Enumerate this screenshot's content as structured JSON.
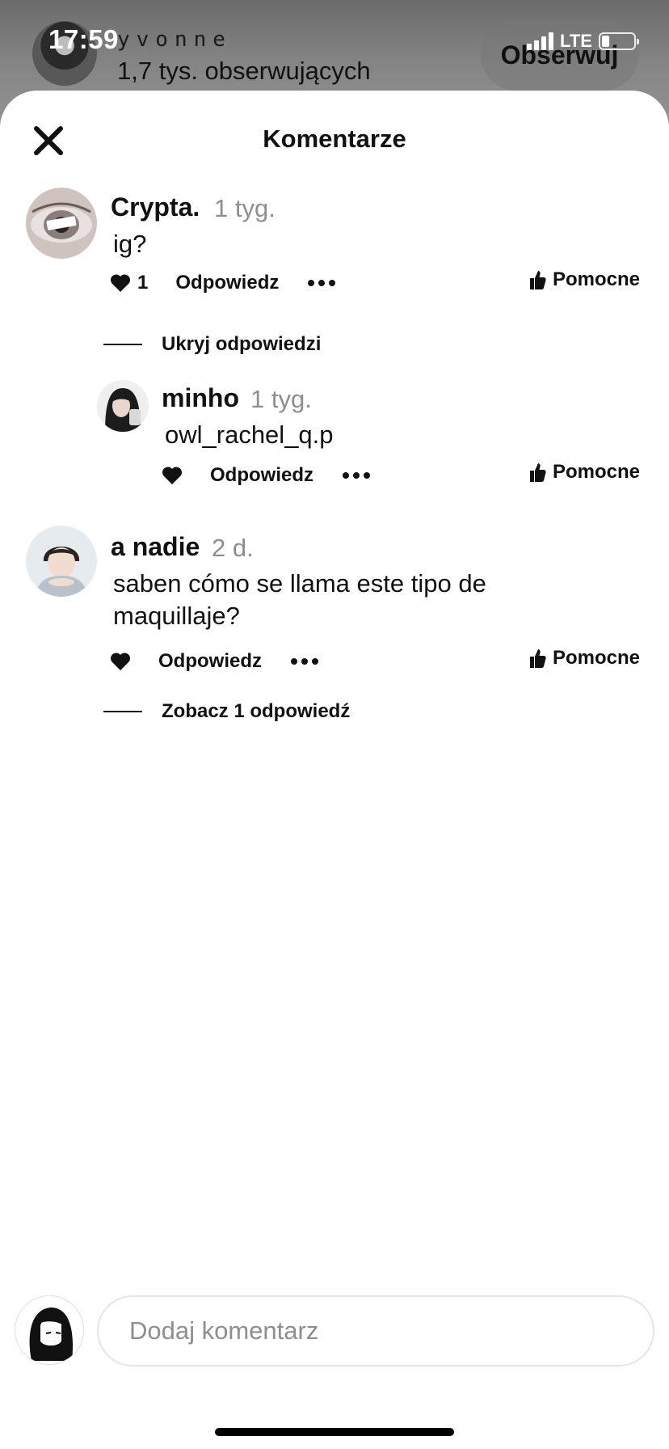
{
  "status_bar": {
    "time": "17:59",
    "network": "LTE"
  },
  "background_profile": {
    "name": "yvonne",
    "followers": "1,7 tys. obserwujących",
    "follow_label": "Obserwuj"
  },
  "sheet": {
    "title": "Komentarze"
  },
  "comments": [
    {
      "author": "Crypta.",
      "time": "1 tyg.",
      "text": "ig?",
      "likes": "1",
      "reply_label": "Odpowiedz",
      "helpful_label": "Pomocne",
      "thread_toggle": "Ukryj odpowiedzi",
      "replies": [
        {
          "author": "minho",
          "time": "1 tyg.",
          "text": "owl_rachel_q.p",
          "reply_label": "Odpowiedz",
          "helpful_label": "Pomocne"
        }
      ]
    },
    {
      "author": "a nadie",
      "time": "2 d.",
      "text_line1": "saben cómo se llama este tipo de",
      "text_line2": "maquillaje?",
      "reply_label": "Odpowiedz",
      "helpful_label": "Pomocne",
      "thread_toggle": "Zobacz 1 odpowiedź"
    }
  ],
  "composer": {
    "placeholder": "Dodaj komentarz"
  }
}
